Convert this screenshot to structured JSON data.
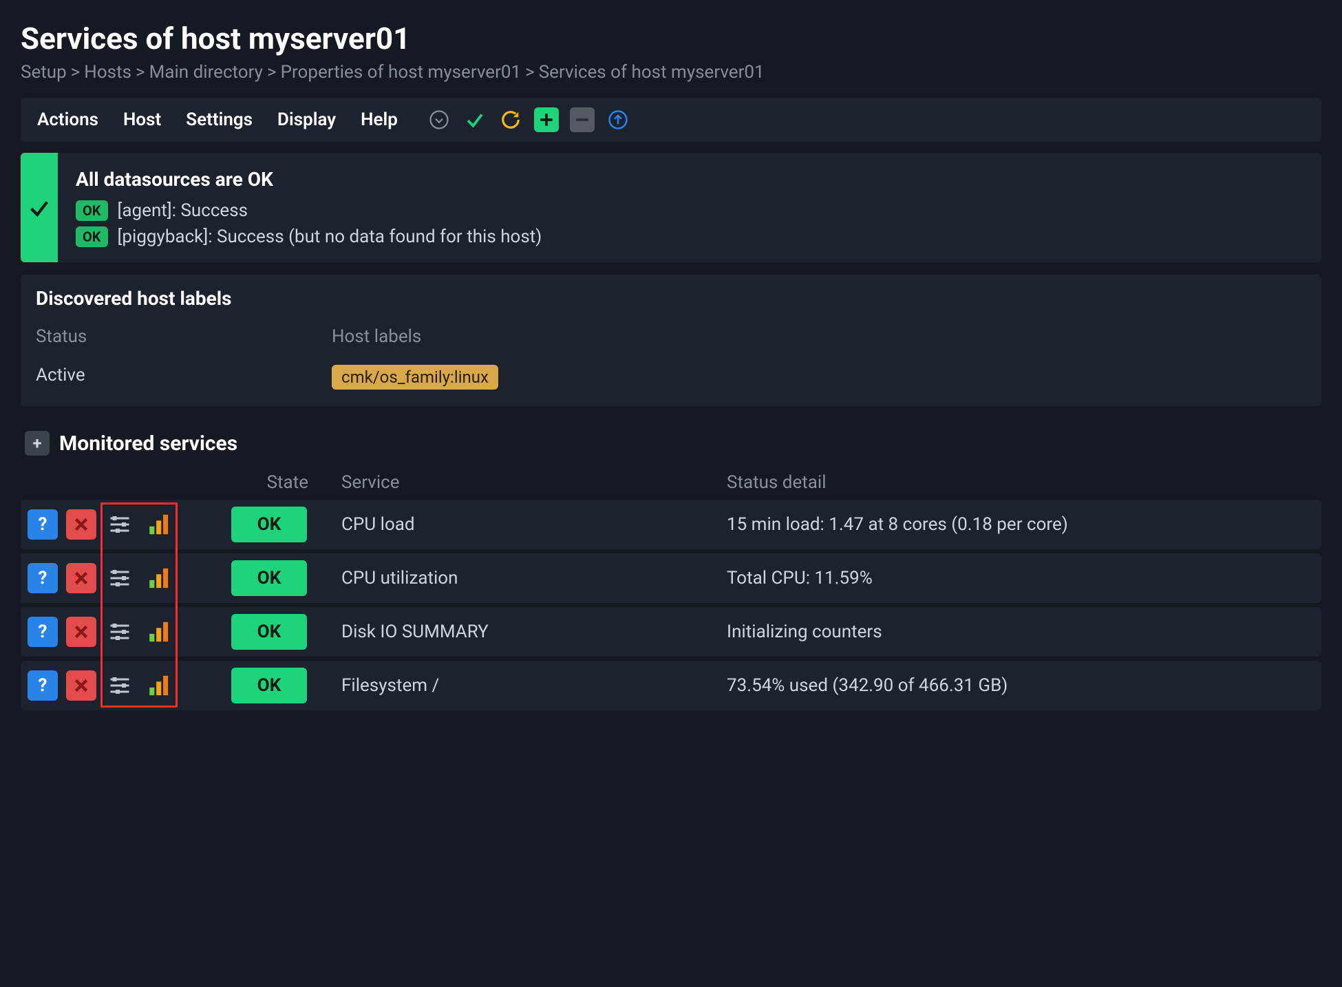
{
  "title": "Services of host myserver01",
  "breadcrumb": [
    {
      "label": "Setup"
    },
    {
      "label": "Hosts"
    },
    {
      "label": "Main directory"
    },
    {
      "label": "Properties of host myserver01"
    },
    {
      "label": "Services of host myserver01"
    }
  ],
  "menu": {
    "actions": "Actions",
    "host": "Host",
    "settings": "Settings",
    "display": "Display",
    "help": "Help"
  },
  "notice": {
    "title": "All datasources are OK",
    "lines": [
      {
        "badge": "OK",
        "text": "[agent]: Success"
      },
      {
        "badge": "OK",
        "text": "[piggyback]: Success (but no data found for this host)"
      }
    ]
  },
  "discovered": {
    "header": "Discovered host labels",
    "col_status": "Status",
    "col_labels": "Host labels",
    "status_value": "Active",
    "label_tag": "cmk/os_family:linux"
  },
  "services": {
    "header": "Monitored services",
    "col_state": "State",
    "col_service": "Service",
    "col_detail": "Status detail",
    "rows": [
      {
        "state": "OK",
        "name": "CPU load",
        "detail": "15 min load: 1.47 at 8 cores (0.18 per core)"
      },
      {
        "state": "OK",
        "name": "CPU utilization",
        "detail": "Total CPU: 11.59%"
      },
      {
        "state": "OK",
        "name": "Disk IO SUMMARY",
        "detail": "Initializing counters"
      },
      {
        "state": "OK",
        "name": "Filesystem /",
        "detail": "73.54% used (342.90 of 466.31 GB)"
      }
    ]
  },
  "icons": {
    "q": "?",
    "plus": "+",
    "minus": "−"
  }
}
